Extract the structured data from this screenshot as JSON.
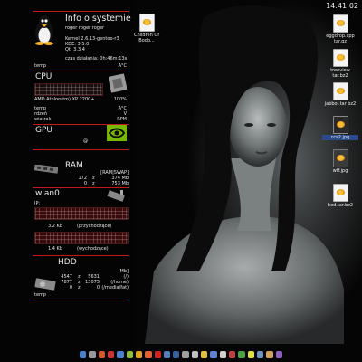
{
  "clock": "14:41:02",
  "sysinfo": {
    "title": "Info o systemie",
    "user": "roger roger roger",
    "kernel": "Kernel 2.6.13-gentoo-r3",
    "kde": "KDE: 3.5.0",
    "qt": "Qt: 3.3.4",
    "uptime": "czas działania: 0h:46m:13s",
    "temp_label": "temp",
    "temp_unit": "A°C"
  },
  "cpu": {
    "title": "CPU",
    "model": "AMD Athlon(tm) XP 2200+",
    "usage": "100%",
    "rows": [
      {
        "label": "temp",
        "value": "A°C"
      },
      {
        "label": "rdzeń",
        "value": "V"
      },
      {
        "label": "wiatrak",
        "value": "RPM"
      }
    ]
  },
  "gpu": {
    "title": "GPU",
    "at": "@"
  },
  "ram": {
    "title": "RAM",
    "header": "[RAM|SWAP]",
    "rows": [
      {
        "a": "172",
        "sep": "z",
        "b": "374 Mb"
      },
      {
        "a": "0",
        "sep": "z",
        "b": "753 Mb"
      }
    ]
  },
  "wlan": {
    "title": "wlan0",
    "ip_label": "IP:",
    "down_value": "3.2 Kb",
    "down_label": "(przychodzące)",
    "up_value": "1.4 Kb",
    "up_label": "(wychodzące)"
  },
  "hdd": {
    "title": "HDD",
    "header": "[Mb]",
    "rows": [
      {
        "a": "4547",
        "sep": "z",
        "b": "5631",
        "c": "(/)"
      },
      {
        "a": "7877",
        "sep": "z",
        "b": "13075",
        "c": "(/home)"
      },
      {
        "a": "0",
        "sep": "z",
        "b": "0",
        "c": "(/media/fat)"
      }
    ],
    "temp_label": "temp"
  },
  "desktop_icons": [
    {
      "label": "Children Of Bodo..."
    },
    {
      "label": "eggdrop.cpp tar.gz"
    },
    {
      "label": "treeview tar.bz2"
    },
    {
      "label": "jabbol.tar bz2"
    },
    {
      "label": "ccs2.jpg"
    },
    {
      "label": "wtf.jpg"
    },
    {
      "label": "bod.tar.bz2"
    }
  ],
  "taskbar_colors": [
    "#4a7fd0",
    "#9a9a9a",
    "#d05a2a",
    "#d03030",
    "#4a7fd0",
    "#8fbf3a",
    "#e0a020",
    "#e06030",
    "#d02020",
    "#5080c0",
    "#3060a0",
    "#a0a0a0",
    "#c0c0c0",
    "#e0c040",
    "#6080d0",
    "#d0d0d0",
    "#c04040",
    "#4aa040",
    "#e0e040",
    "#7090c0",
    "#d0a060",
    "#9060c0"
  ]
}
